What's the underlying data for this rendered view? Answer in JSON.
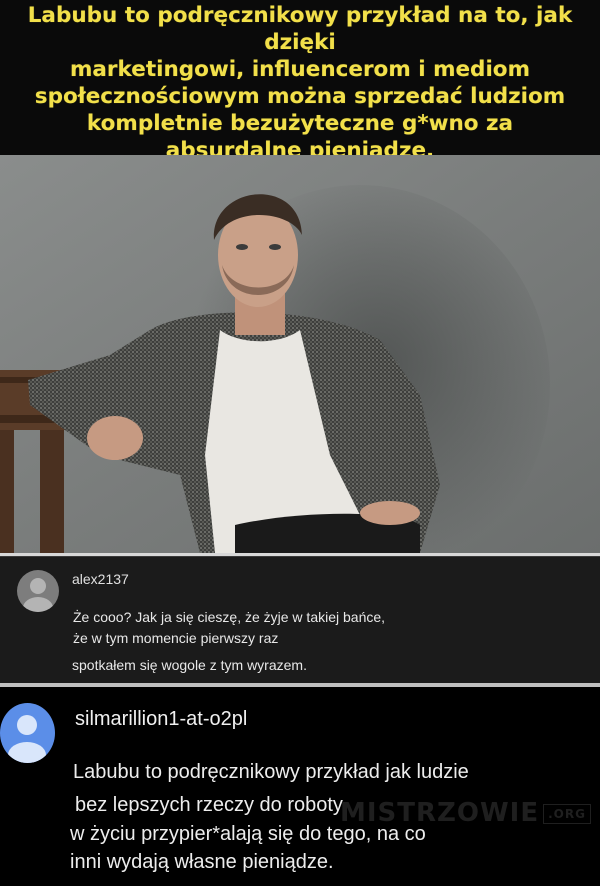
{
  "caption": {
    "line1": "Labubu to podręcznikowy przykład na to, jak dzięki",
    "line2": "marketingowi, influencerom i mediom",
    "line3": "społecznościowym można sprzedać ludziom",
    "line4": "kompletnie bezużyteczne g*wno za",
    "line5": "absurdalne pieniądze."
  },
  "photo": {
    "alt_icon": "portrait-photo"
  },
  "comment1": {
    "username": "alex2137",
    "line1": "Że cooo? Jak ja się cieszę, że żyje w takiej bańce,",
    "line2": "że w tym momencie pierwszy  raz",
    "line3": "spotkałem się wogole z tym wyrazem."
  },
  "comment2": {
    "username": "silmarillion1-at-o2pl",
    "line1": "Labubu to podręcznikowy przykład jak ludzie",
    "line2": "bez lepszych rzeczy do roboty",
    "line3": "w życiu przypier*alają się do tego, na co",
    "line4": "inni wydają własne pieniądze."
  },
  "watermark": {
    "text": "MISTRZOWIE",
    "suffix": ".ORG"
  },
  "colors": {
    "caption_text": "#f2e04a",
    "avatar2": "#5b8ee8",
    "avatar1": "#7d7d7d"
  }
}
